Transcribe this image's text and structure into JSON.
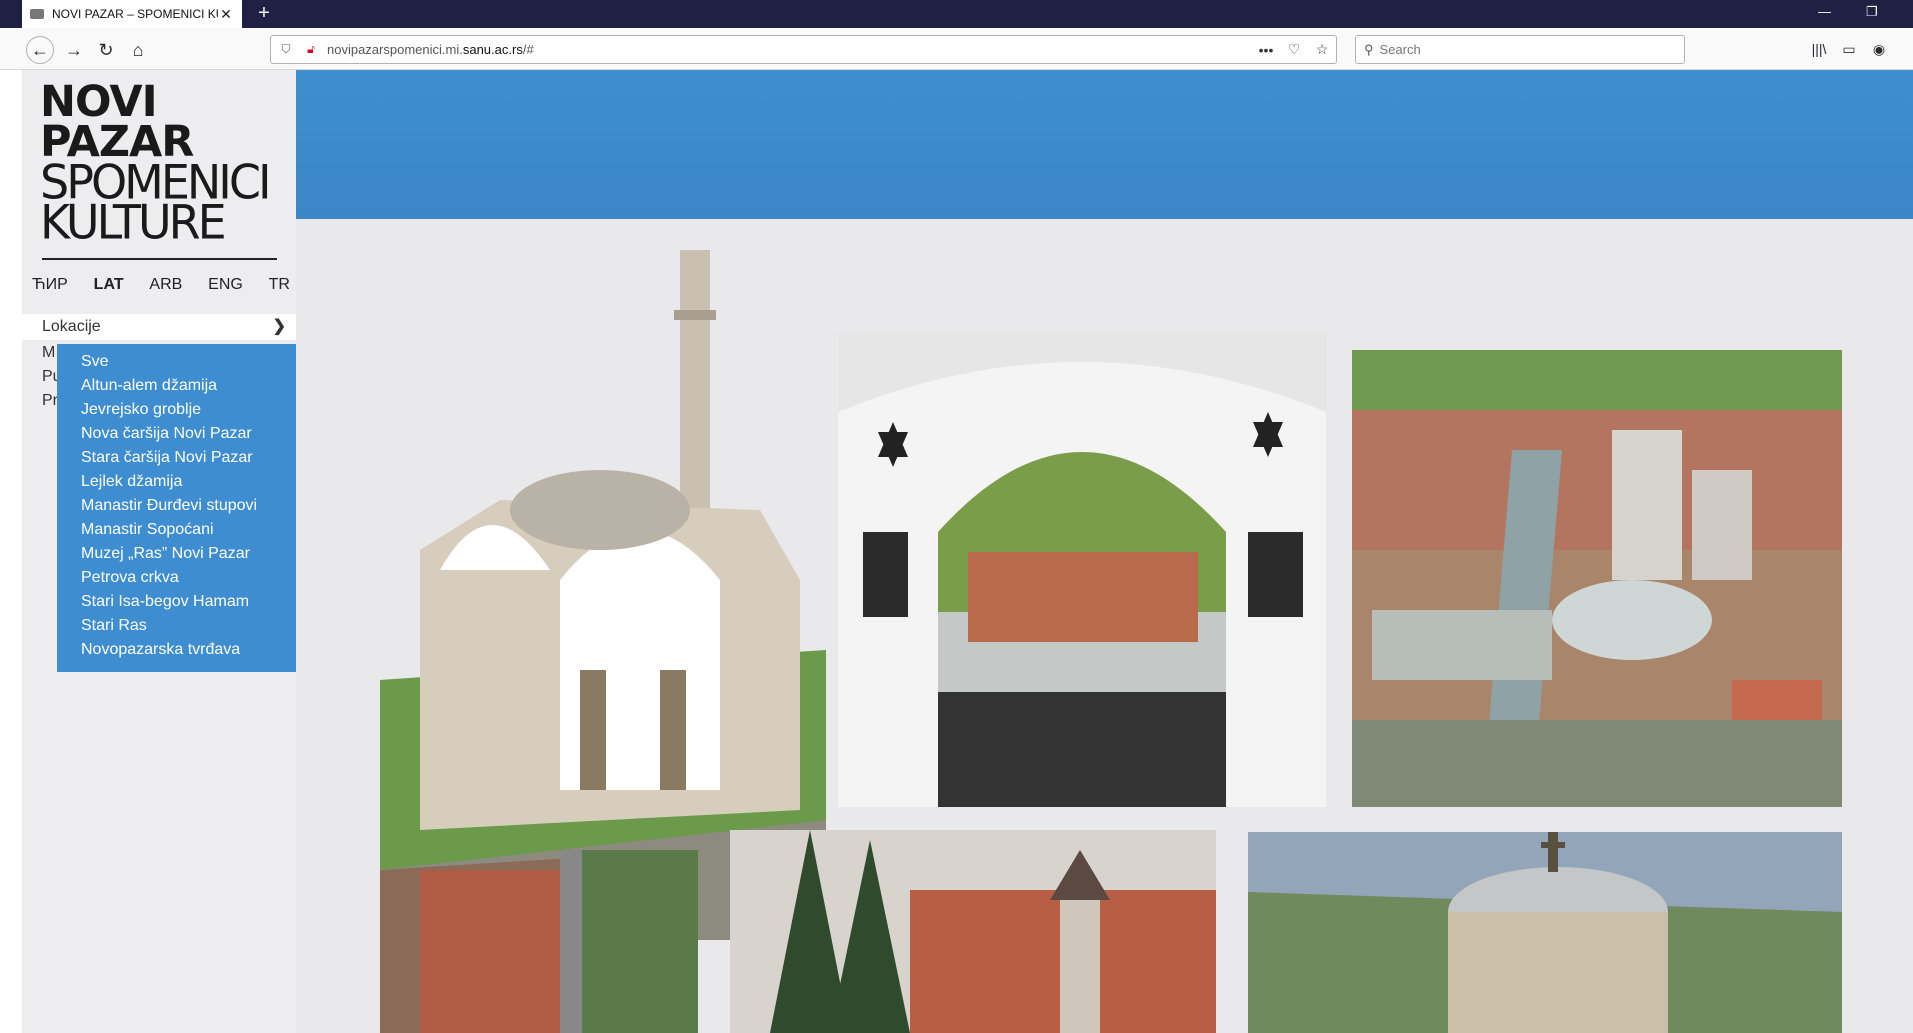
{
  "browser": {
    "tab_title": "NOVI PAZAR – SPOMENICI KUL",
    "url_prefix": "novipazarspomenici.mi.",
    "url_domain": "sanu.ac.rs",
    "url_suffix": "/#",
    "search_placeholder": "Search"
  },
  "logo": {
    "line1": "NOVI",
    "line2": "PAZAR",
    "line3": "SPOMENICI",
    "line4": "KULTURE"
  },
  "languages": [
    "ЋИР",
    "LAT",
    "ARB",
    "ENG",
    "TR"
  ],
  "active_language": "LAT",
  "menu": {
    "open_item": "Lokacije",
    "hidden_items": [
      "M",
      "Pu",
      "Pr"
    ]
  },
  "dropdown": [
    "Sve",
    "Altun-alem džamija",
    "Jevrejsko groblje",
    "Nova čaršija Novi Pazar",
    "Stara čaršija Novi Pazar",
    "Lejlek džamija",
    "Manastir Đurđevi stupovi",
    "Manastir Sopoćani",
    "Muzej „Ras” Novi Pazar",
    "Petrova crkva",
    "Stari Isa-begov Hamam",
    "Stari Ras",
    "Novopazarska tvrđava"
  ],
  "colors": {
    "banner": "#3e8fce",
    "dropdown": "#3d8dd0",
    "tabstrip": "#1f2043"
  }
}
